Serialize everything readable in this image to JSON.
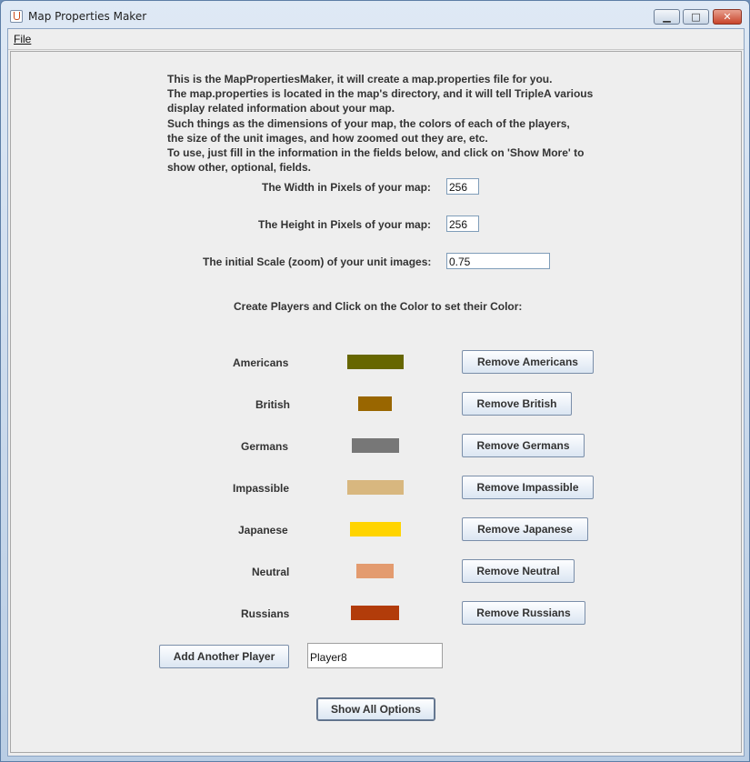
{
  "window": {
    "title": "Map Properties Maker",
    "min_glyph": "▁",
    "max_glyph": "□",
    "close_glyph": "✕"
  },
  "menubar": {
    "file_label": "File"
  },
  "intro": {
    "lines": [
      "This is the MapPropertiesMaker, it will create a map.properties file for you.",
      "The map.properties is located in the map's directory, and it will tell TripleA various",
      "display related information about your map.",
      "Such things as the dimensions of your map, the colors of each of the players,",
      "the size of the unit images, and how zoomed out they are, etc.",
      "To use, just fill in the information in the fields below, and click on 'Show More' to",
      "show other, optional, fields."
    ]
  },
  "fields": {
    "width_label": "The Width in Pixels of your map:",
    "width_value": "256",
    "height_label": "The Height in Pixels of your map:",
    "height_value": "256",
    "scale_label": "The initial Scale (zoom) of your unit images:",
    "scale_value": "0.75"
  },
  "players_heading": "Create Players and Click on the Color to set their Color:",
  "players": [
    {
      "name": "Americans",
      "color": "#666600",
      "remove_label": "Remove Americans"
    },
    {
      "name": "British",
      "color": "#996600",
      "remove_label": "Remove British"
    },
    {
      "name": "Germans",
      "color": "#777777",
      "remove_label": "Remove Germans"
    },
    {
      "name": "Impassible",
      "color": "#d8b77f",
      "remove_label": "Remove Impassible"
    },
    {
      "name": "Japanese",
      "color": "#ffd400",
      "remove_label": "Remove Japanese"
    },
    {
      "name": "Neutral",
      "color": "#e39b6f",
      "remove_label": "Remove Neutral"
    },
    {
      "name": "Russians",
      "color": "#b23c0a",
      "remove_label": "Remove Russians"
    }
  ],
  "add_player": {
    "button_label": "Add Another Player",
    "new_name_value": "Player8"
  },
  "show_all_label": "Show All Options"
}
